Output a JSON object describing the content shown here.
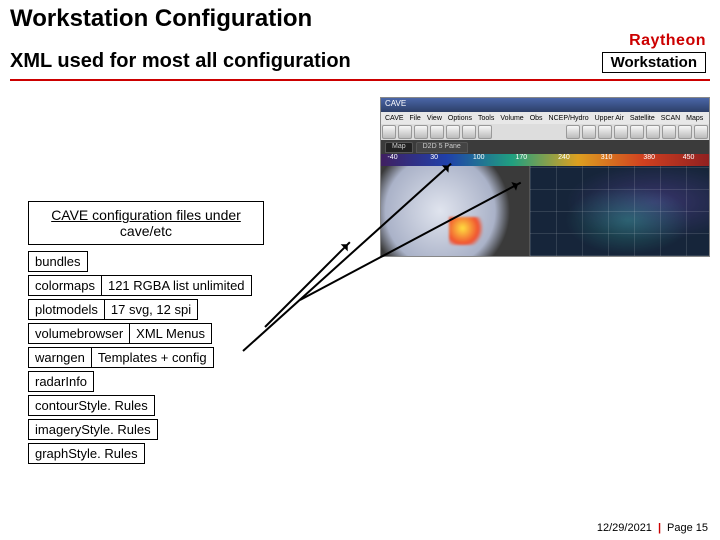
{
  "header": {
    "title": "Workstation Configuration",
    "subtitle": "XML used for most all configuration",
    "logo_text": "Raytheon",
    "workstation_box": "Workstation"
  },
  "screenshot": {
    "titlebar": "CAVE",
    "menus": [
      "CAVE",
      "File",
      "View",
      "Options",
      "Tools",
      "Volume",
      "Obs",
      "NCEP/Hydro",
      "Upper Air",
      "Satellite",
      "SCAN",
      "Maps"
    ],
    "tab_a": "Map",
    "tab_b": "D2D 5 Pane",
    "legend_vals": [
      "-40",
      "30",
      "100",
      "170",
      "240",
      "310",
      "380",
      "450"
    ]
  },
  "callout": {
    "line1": "CAVE configuration files under",
    "line2": "cave/etc"
  },
  "rows": {
    "bundles": {
      "label": "bundles"
    },
    "colormaps": {
      "label": "colormaps",
      "detail": "121 RGBA list unlimited"
    },
    "plotmodels": {
      "label": "plotmodels",
      "detail": "17 svg,  12 spi"
    },
    "volumebrowser": {
      "label": "volumebrowser",
      "detail": "XML Menus"
    },
    "warngen": {
      "label": "warngen",
      "detail": "Templates + config"
    },
    "radarinfo": {
      "label": "radarInfo"
    },
    "contour": {
      "label": "contourStyle. Rules"
    },
    "imagery": {
      "label": "imageryStyle. Rules"
    },
    "graph": {
      "label": "graphStyle. Rules"
    }
  },
  "footer": {
    "date": "12/29/2021",
    "page": "Page 15"
  }
}
